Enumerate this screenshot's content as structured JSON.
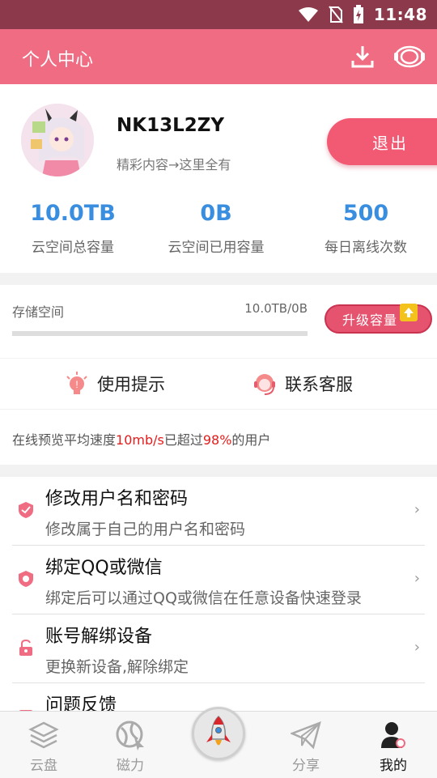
{
  "status_bar": {
    "time": "11:48"
  },
  "app_bar": {
    "title": "个人中心",
    "icons": [
      "download-icon",
      "customer-service-icon"
    ]
  },
  "profile": {
    "username": "NK13L2ZY",
    "slogan": "精彩内容→这里全有",
    "logout_label": "退出",
    "stats": [
      {
        "value": "10.0TB",
        "label": "云空间总容量"
      },
      {
        "value": "0B",
        "label": "云空间已用容量"
      },
      {
        "value": "500",
        "label": "每日离线次数"
      }
    ]
  },
  "storage": {
    "label": "存储空间",
    "value": "10.0TB/0B",
    "used_fraction": 0.0,
    "upgrade_label": "升级容量"
  },
  "tips": {
    "usage_label": "使用提示",
    "contact_label": "联系客服"
  },
  "speed": {
    "prefix": "在线预览平均速度",
    "speed": "10mb/s",
    "middle": "已超过",
    "percent": "98%",
    "suffix": "的用户"
  },
  "menu": [
    {
      "title": "修改用户名和密码",
      "subtitle": "修改属于自己的用户名和密码",
      "icon": "shield-icon"
    },
    {
      "title": "绑定QQ或微信",
      "subtitle": "绑定后可以通过QQ或微信在任意设备快速登录",
      "icon": "bind-icon"
    },
    {
      "title": "账号解绑设备",
      "subtitle": "更换新设备,解除绑定",
      "icon": "unlock-icon"
    },
    {
      "title": "问题反馈",
      "subtitle": "",
      "icon": "feedback-icon"
    }
  ],
  "tabbar": [
    {
      "label": "云盘",
      "icon": "layers-icon"
    },
    {
      "label": "磁力",
      "icon": "magnet-globe-icon"
    },
    {
      "label": "",
      "icon": "rocket-icon"
    },
    {
      "label": "分享",
      "icon": "paper-plane-icon"
    },
    {
      "label": "我的",
      "icon": "user-icon"
    }
  ],
  "colors": {
    "accent": "#f06c82",
    "stat_blue": "#3a8ee0",
    "status_bar": "#8c3a4b",
    "highlight_red": "#e21d1d"
  }
}
